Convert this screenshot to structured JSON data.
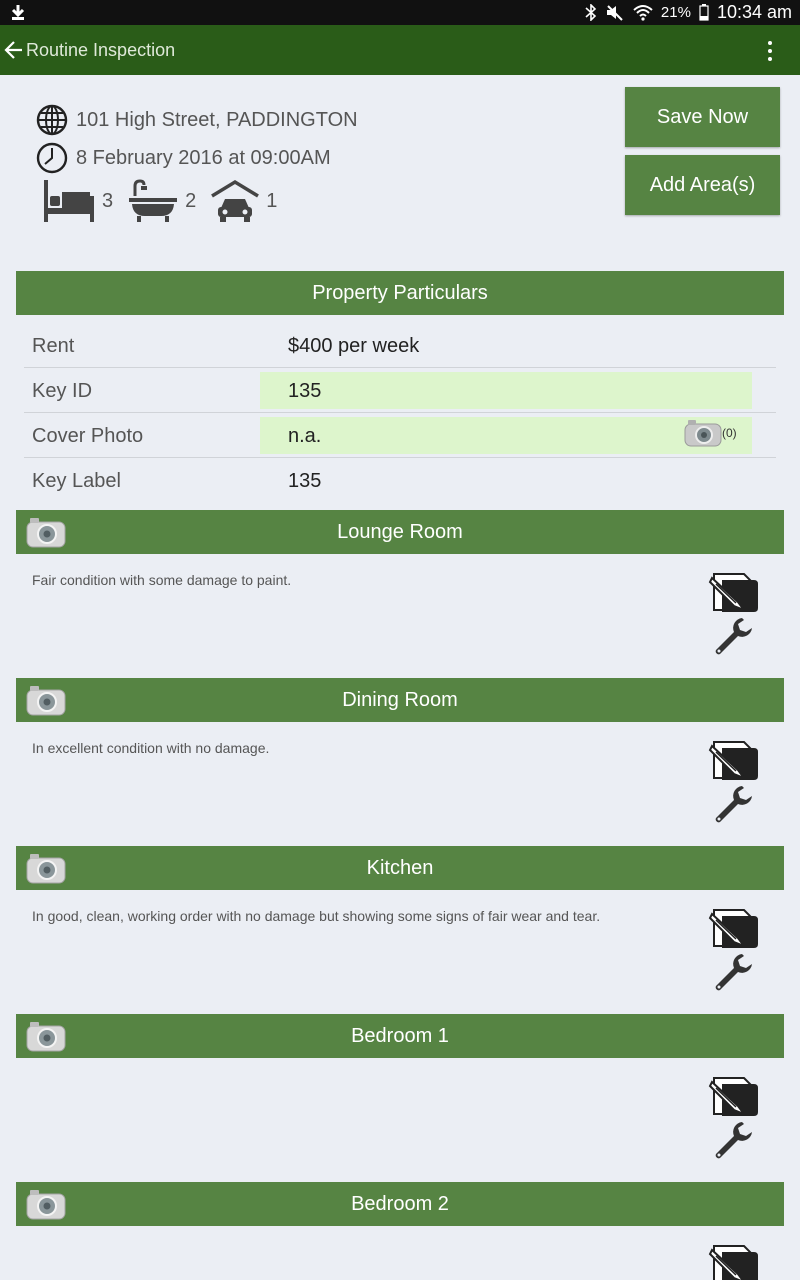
{
  "status_bar": {
    "battery": "21%",
    "time": "10:34 am"
  },
  "app_bar": {
    "title": "Routine Inspection"
  },
  "property": {
    "address": "101 High Street, PADDINGTON",
    "datetime": "8 February 2016 at 09:00AM",
    "bedrooms": "3",
    "bathrooms": "2",
    "garages": "1"
  },
  "actions": {
    "save": "Save Now",
    "add_area": "Add Area(s)"
  },
  "particulars": {
    "title": "Property Particulars",
    "rows": [
      {
        "label": "Rent",
        "value": "$400 per week"
      },
      {
        "label": "Key ID",
        "value": "135"
      },
      {
        "label": "Cover Photo",
        "value": "n.a.",
        "photo_count": "(0)"
      },
      {
        "label": "Key Label",
        "value": "135"
      }
    ]
  },
  "areas": [
    {
      "name": "Lounge Room",
      "note": "Fair condition with some damage to paint."
    },
    {
      "name": "Dining Room",
      "note": "In excellent condition with no damage."
    },
    {
      "name": "Kitchen",
      "note": "In good, clean, working order with no damage but showing some signs of fair wear and tear."
    },
    {
      "name": "Bedroom 1",
      "note": ""
    },
    {
      "name": "Bedroom 2",
      "note": ""
    }
  ]
}
